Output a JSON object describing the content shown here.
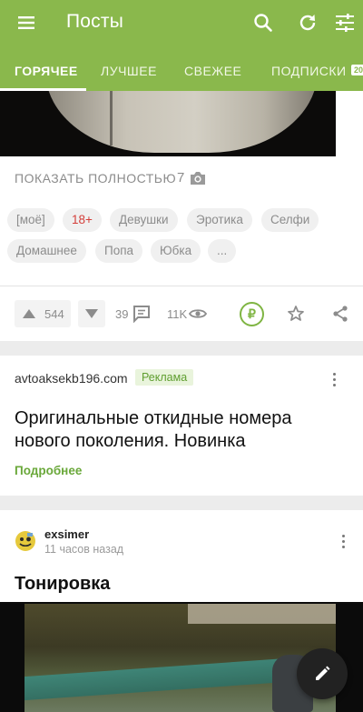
{
  "appbar": {
    "title": "Посты",
    "menu_icon": "hamburger-menu-icon",
    "actions": [
      "search-icon",
      "refresh-icon",
      "filter-sliders-icon"
    ],
    "background": "#8ab84c"
  },
  "tabs": [
    {
      "label": "ГОРЯЧЕЕ",
      "active": true
    },
    {
      "label": "ЛУЧШЕЕ",
      "active": false
    },
    {
      "label": "СВЕЖЕЕ",
      "active": false
    },
    {
      "label": "ПОДПИСКИ",
      "active": false
    }
  ],
  "tabs_badge": "20",
  "post1": {
    "show_full": "ПОКАЗАТЬ ПОЛНОСТЬЮ",
    "image_count": "7",
    "tags": [
      "[моё]",
      "18+",
      "Девушки",
      "Эротика",
      "Селфи",
      "Домашнее",
      "Попа",
      "Юбка",
      "..."
    ],
    "rating": "544",
    "comments": "39",
    "views": "11K",
    "donate_symbol": "₽"
  },
  "ad": {
    "domain": "avtoaksekb196.com",
    "badge": "Реклама",
    "headline": "Оригинальные откидные номера нового поколения. Новинка",
    "more": "Подробнее"
  },
  "post2": {
    "author": "exsimer",
    "time": "11 часов назад",
    "title": "Тонировка"
  },
  "colors": {
    "accent": "#8ab84c",
    "tag_red": "#d43f3a",
    "link_green": "#6aa83a"
  }
}
